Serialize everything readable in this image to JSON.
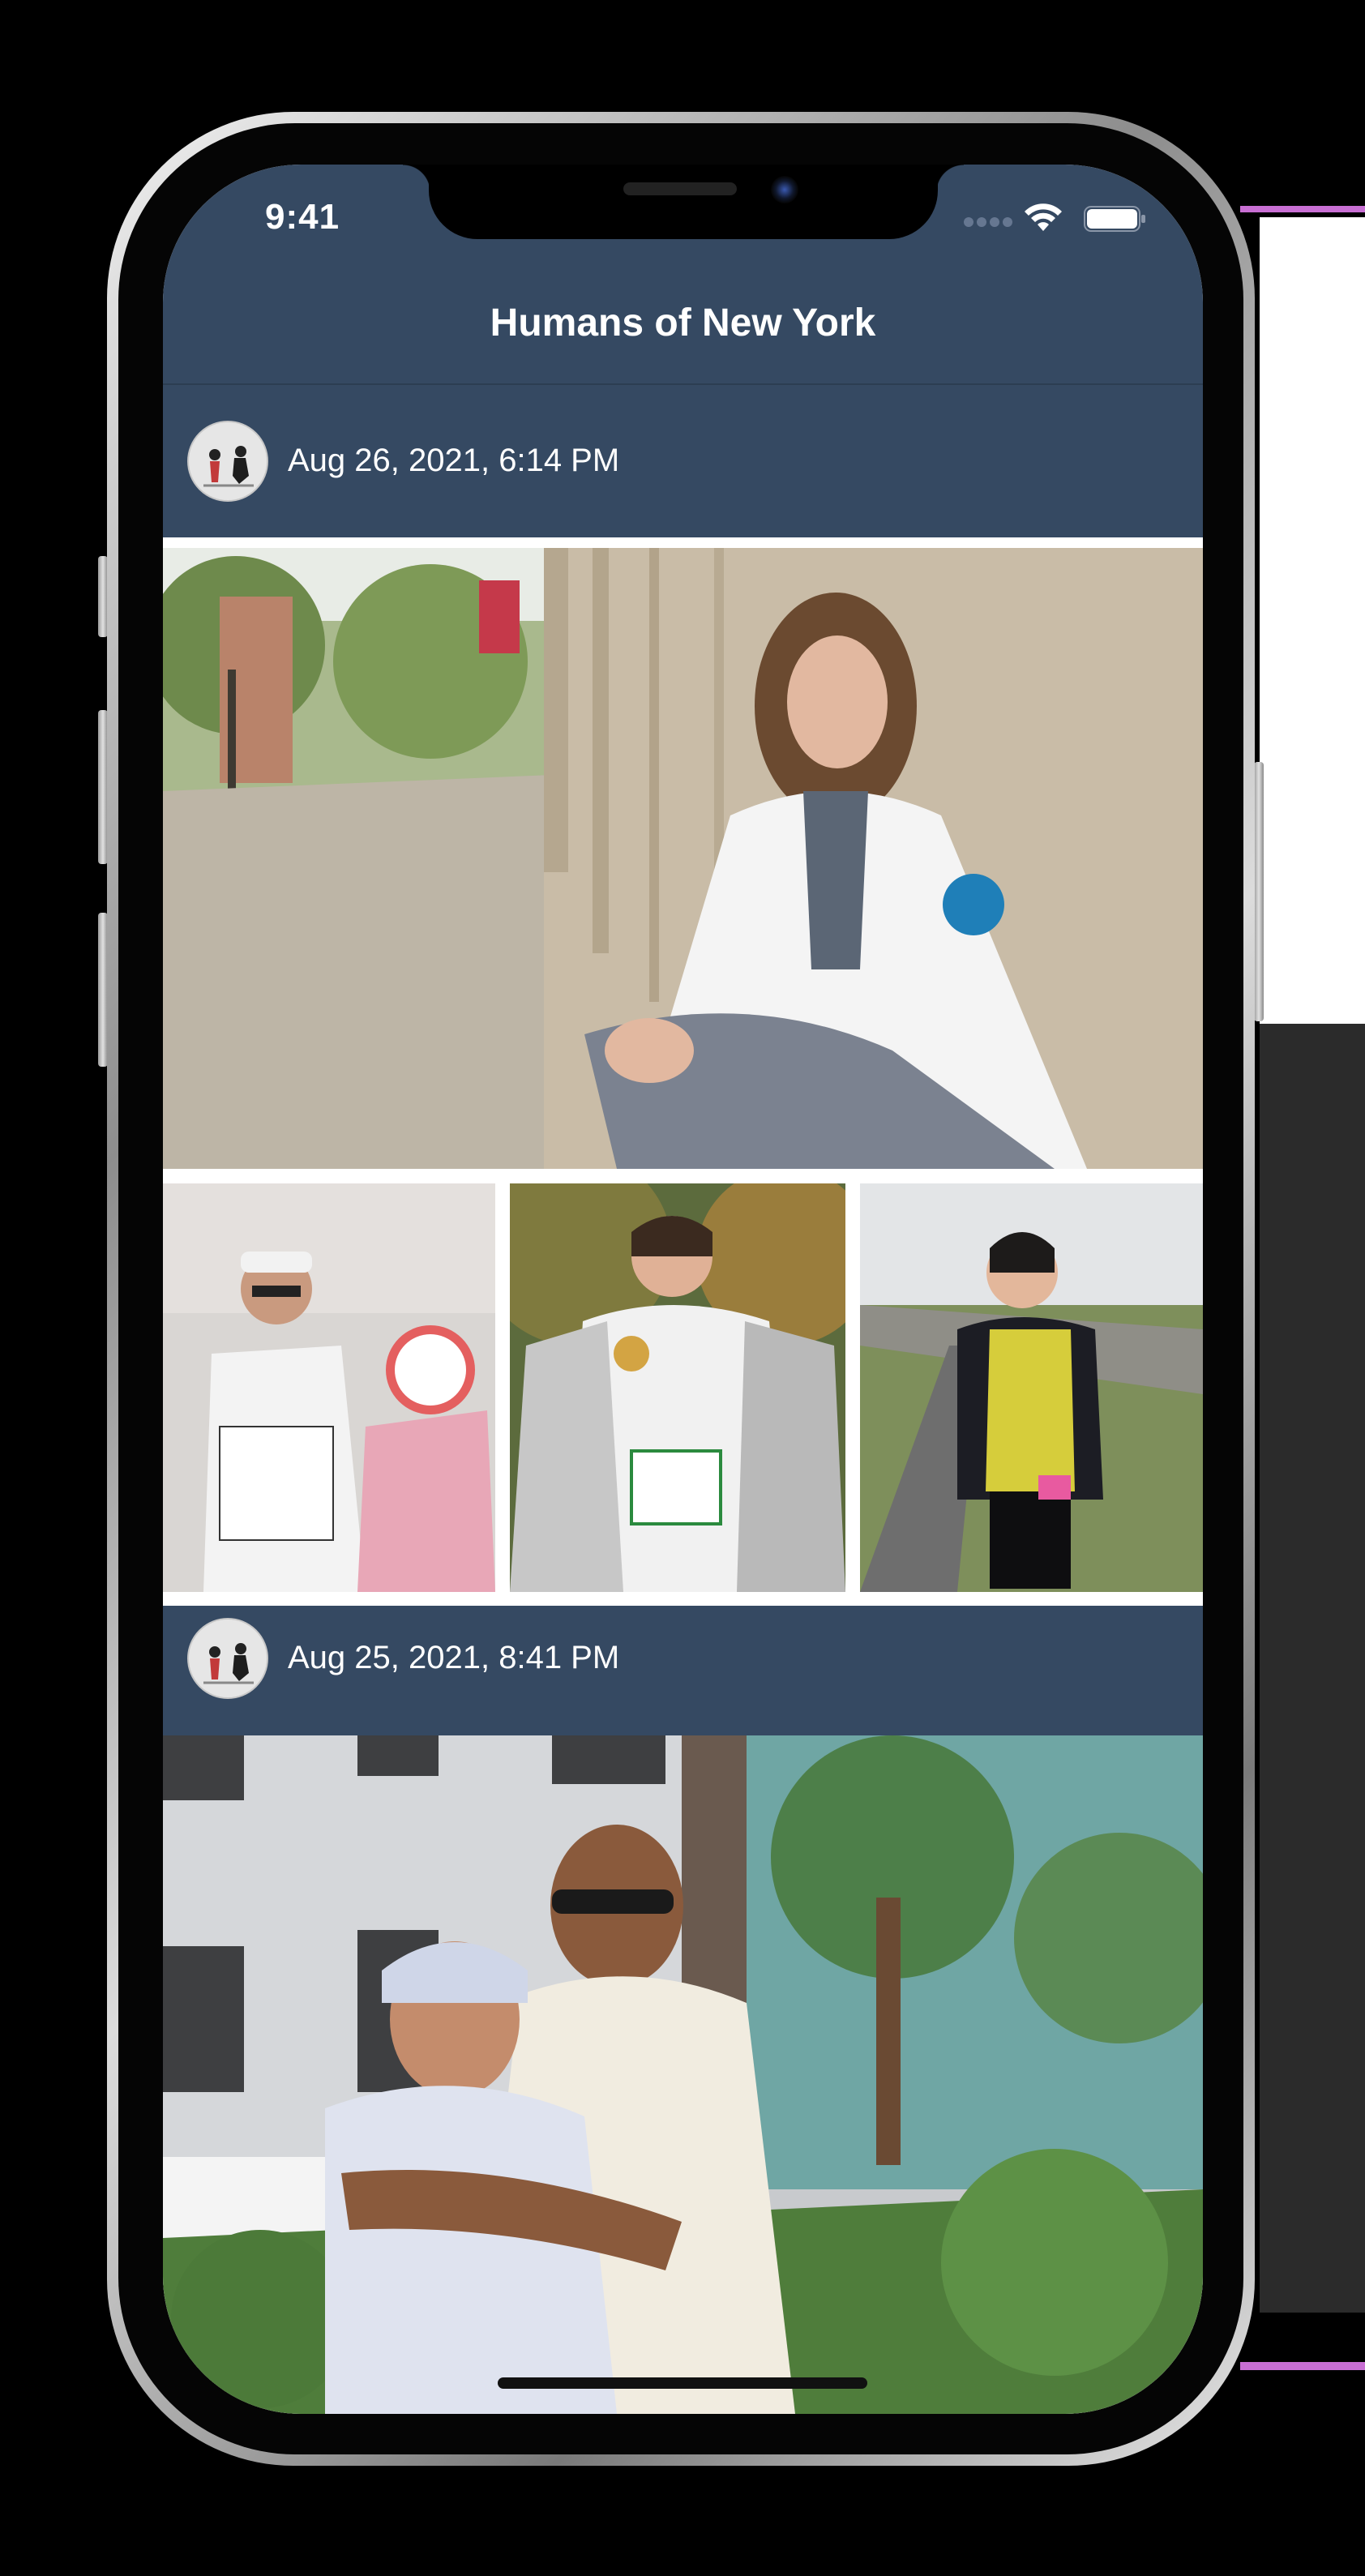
{
  "status_bar": {
    "time": "9:41"
  },
  "header": {
    "title": "Humans of New York"
  },
  "posts": [
    {
      "date": "Aug 26, 2021, 6:14 PM"
    },
    {
      "date": "Aug 25, 2021, 8:41 PM"
    }
  ],
  "colors": {
    "header_bg": "#354962",
    "post_bar_bg": "#354962",
    "text": "#ffffff"
  },
  "icons": [
    "signal-icon",
    "wifi-icon",
    "battery-icon",
    "avatar"
  ]
}
